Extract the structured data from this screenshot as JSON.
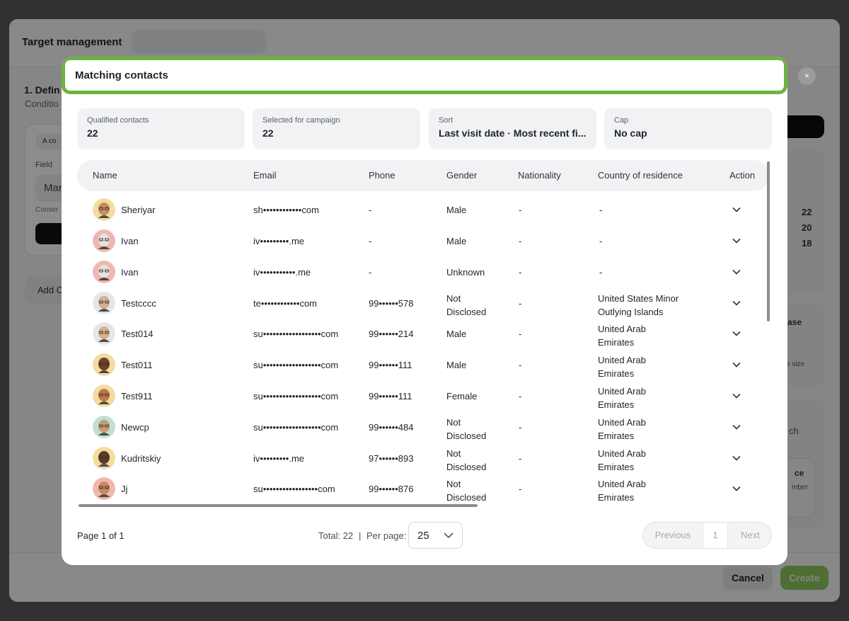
{
  "background": {
    "page_title": "Target management",
    "section_title": "1. Defin",
    "section_sub": "Conditio",
    "chip": "A co",
    "field_label": "Field",
    "field_value": "Mar",
    "consent_label": "Conser",
    "add_label": "Add C",
    "right_numbers": [
      "22",
      "20",
      "18"
    ],
    "right_frag_1": "ase",
    "right_frag_2": "e size",
    "right_frag_3": "ch",
    "right_frag_4": "ce",
    "right_frag_5": "mber",
    "cancel_label": "Cancel",
    "create_label": "Create"
  },
  "modal": {
    "title": "Matching contacts",
    "close_label": "×",
    "stats": [
      {
        "label": "Qualified contacts",
        "value": "22"
      },
      {
        "label": "Selected for campaign",
        "value": "22"
      },
      {
        "label": "Sort",
        "value": "Last visit date · Most recent fi..."
      },
      {
        "label": "Cap",
        "value": "No cap"
      }
    ],
    "columns": [
      "Name",
      "Email",
      "Phone",
      "Gender",
      "Nationality",
      "Country of residence",
      "Action"
    ],
    "rows": [
      {
        "name": "Sheriyar",
        "email": "sh••••••••••••com",
        "phone": "-",
        "gender": [
          "Male"
        ],
        "nationality": "-",
        "country": [
          "-"
        ],
        "avatar_bg": "#f3dca0"
      },
      {
        "name": "Ivan",
        "email": "iv•••••••••.me",
        "phone": "-",
        "gender": [
          "Male"
        ],
        "nationality": "-",
        "country": [
          "-"
        ],
        "avatar_bg": "#f0b6b0"
      },
      {
        "name": "Ivan",
        "email": "iv•••••••••••.me",
        "phone": "-",
        "gender": [
          "Unknown"
        ],
        "nationality": "-",
        "country": [
          "-"
        ],
        "avatar_bg": "#f0b6b0"
      },
      {
        "name": "Testcccc",
        "email": "te••••••••••••com",
        "phone": "99••••••578",
        "gender": [
          "Not",
          "Disclosed"
        ],
        "nationality": "-",
        "country": [
          "United States Minor",
          "Outlying Islands"
        ],
        "avatar_bg": "#e4e6ea"
      },
      {
        "name": "Test014",
        "email": "su••••••••••••••••••com",
        "phone": "99••••••214",
        "gender": [
          "Male"
        ],
        "nationality": "-",
        "country": [
          "United Arab",
          "Emirates"
        ],
        "avatar_bg": "#e4e6ea"
      },
      {
        "name": "Test011",
        "email": "su••••••••••••••••••com",
        "phone": "99••••••111",
        "gender": [
          "Male"
        ],
        "nationality": "-",
        "country": [
          "United Arab",
          "Emirates"
        ],
        "avatar_bg": "#f3dca0"
      },
      {
        "name": "Test911",
        "email": "su••••••••••••••••••com",
        "phone": "99••••••111",
        "gender": [
          "Female"
        ],
        "nationality": "-",
        "country": [
          "United Arab",
          "Emirates"
        ],
        "avatar_bg": "#f3dca0"
      },
      {
        "name": "Newcp",
        "email": "su••••••••••••••••••com",
        "phone": "99••••••484",
        "gender": [
          "Not",
          "Disclosed"
        ],
        "nationality": "-",
        "country": [
          "United Arab",
          "Emirates"
        ],
        "avatar_bg": "#bfe0d2"
      },
      {
        "name": "Kudritskiy",
        "email": "iv•••••••••.me",
        "phone": "97••••••893",
        "gender": [
          "Not",
          "Disclosed"
        ],
        "nationality": "-",
        "country": [
          "United Arab",
          "Emirates"
        ],
        "avatar_bg": "#f3dca0"
      },
      {
        "name": "Jj",
        "email": "su•••••••••••••••••com",
        "phone": "99••••••876",
        "gender": [
          "Not",
          "Disclosed"
        ],
        "nationality": "-",
        "country": [
          "United Arab",
          "Emirates"
        ],
        "avatar_bg": "#f0b6b0"
      }
    ],
    "footer": {
      "page_info": "Page 1 of 1",
      "total": "Total: 22",
      "separator": "|",
      "per_page_label": "Per page:",
      "per_page_value": "25",
      "prev_label": "Previous",
      "current_page": "1",
      "next_label": "Next"
    }
  }
}
